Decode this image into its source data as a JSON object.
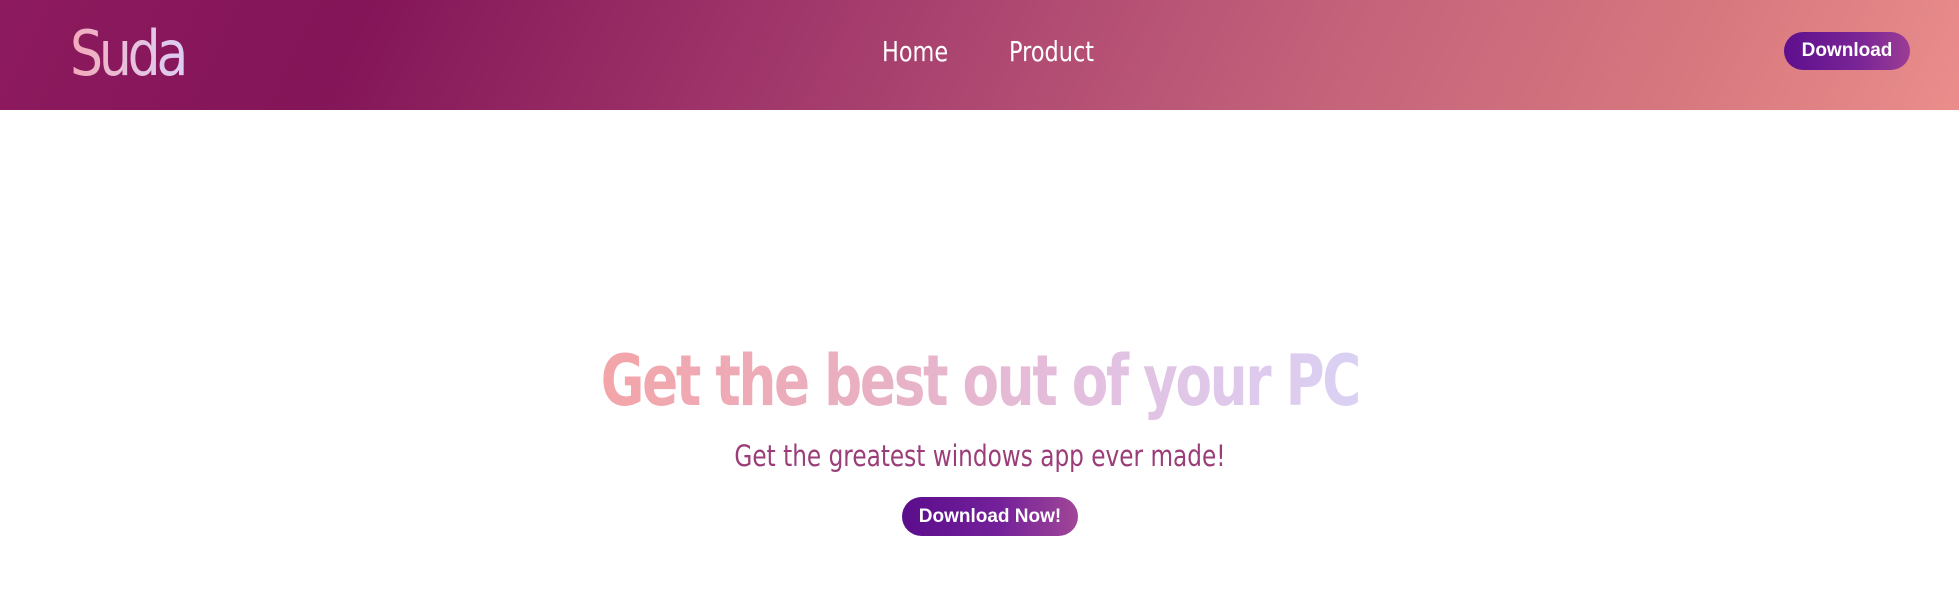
{
  "navbar": {
    "brand": "Suda",
    "links": [
      {
        "label": "Home"
      },
      {
        "label": "Product"
      }
    ],
    "download_label": "Download"
  },
  "hero": {
    "title": "Get the best out of your PC",
    "subtitle": "Get the greatest windows app ever made!",
    "cta_label": "Download Now!"
  },
  "colors": {
    "navbar_gradient_start": "#8d1a5e",
    "navbar_gradient_end": "#ea8d8b",
    "button_gradient_start": "#5e0f8e",
    "button_gradient_end": "#9b3d95",
    "subtitle": "#9a3d78",
    "title_gradient_start": "#f3a5a9",
    "title_gradient_end": "#dad1f4"
  }
}
